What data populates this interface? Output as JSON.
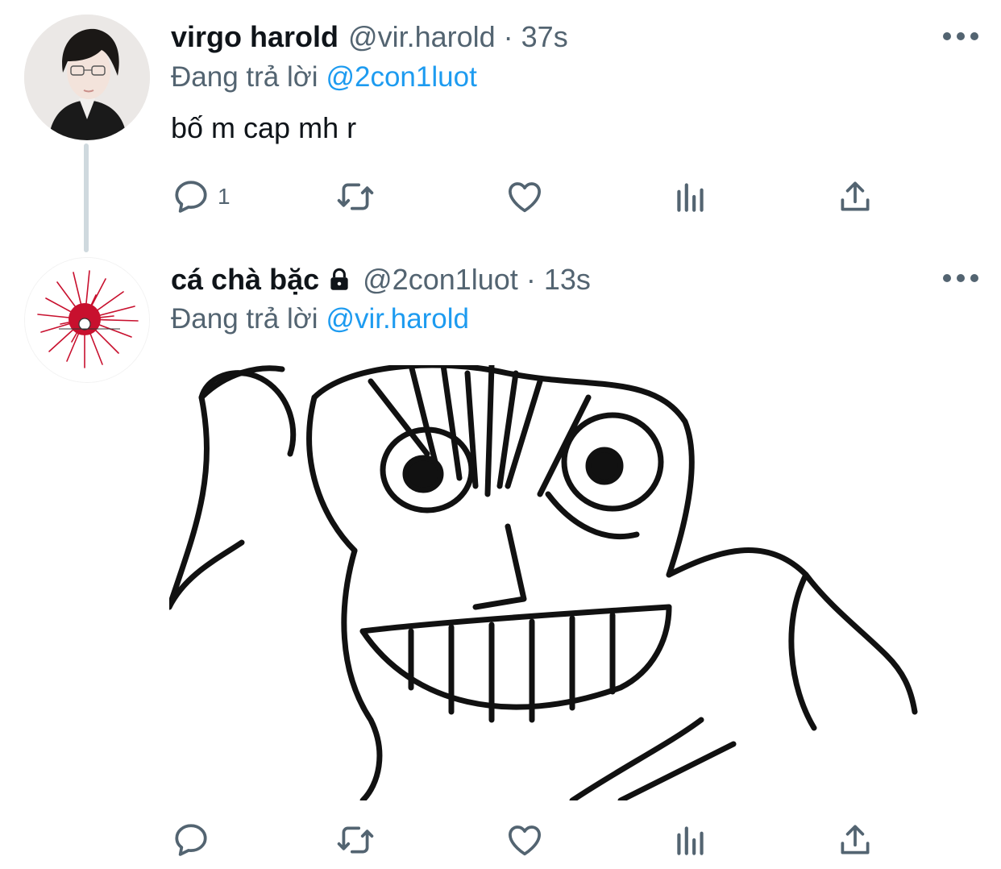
{
  "tweets": [
    {
      "name": "virgo harold",
      "handle": "@vir.harold",
      "separator": "·",
      "time": "37s",
      "replying_prefix": "Đang trả lời",
      "replying_to": "@2con1luot",
      "text": "bố m cap mh r",
      "reply_count": "1",
      "protected": false
    },
    {
      "name": "cá chà bặc",
      "handle": "@2con1luot",
      "separator": "·",
      "time": "13s",
      "replying_prefix": "Đang trả lời",
      "replying_to": "@vir.harold",
      "text": "",
      "reply_count": "",
      "protected": true,
      "has_media": true
    }
  ],
  "icons": {
    "reply": "reply-icon",
    "retweet": "retweet-icon",
    "like": "heart-icon",
    "stats": "stats-icon",
    "share": "share-icon",
    "more": "more-icon",
    "lock": "lock-icon"
  },
  "colors": {
    "link": "#1d9bf0",
    "secondary_text": "#536471",
    "primary_text": "#0f1419",
    "thread_line": "#cfd9de"
  }
}
